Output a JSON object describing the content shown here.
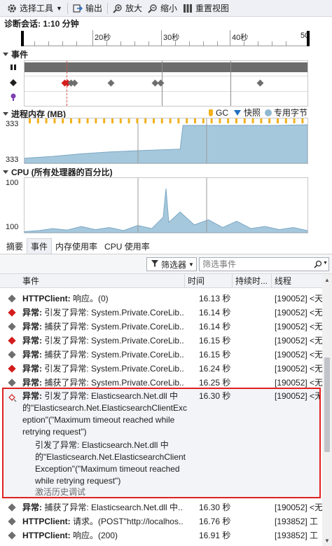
{
  "toolbar": {
    "select_tool": "选择工具",
    "export": "输出",
    "zoom_in": "放大",
    "zoom_out": "缩小",
    "reset_view": "重置视图"
  },
  "session": {
    "label": "诊断会话: 1:10 分钟"
  },
  "ruler": {
    "labels": [
      "20秒",
      "30秒",
      "40秒",
      "50"
    ]
  },
  "events_section": {
    "title": "事件"
  },
  "memory_section": {
    "title": "进程内存 (MB)",
    "y_max": "333",
    "y_min": "333"
  },
  "legend": {
    "gc": "GC",
    "snapshot": "快照",
    "private_bytes": "专用字节"
  },
  "cpu_section": {
    "title": "CPU (所有处理器的百分比)",
    "y_max": "100",
    "y_min": "100"
  },
  "chart_data": [
    {
      "type": "area",
      "title": "进程内存 (MB)",
      "ylim": [
        0,
        333
      ],
      "x": [
        0,
        0.1,
        0.2,
        0.3,
        0.4,
        0.5,
        0.55,
        0.56,
        0.6,
        0.7,
        0.8,
        0.9,
        1.0
      ],
      "values": [
        40,
        55,
        75,
        90,
        100,
        108,
        112,
        300,
        300,
        300,
        300,
        300,
        305
      ]
    },
    {
      "type": "area",
      "title": "CPU (所有处理器的百分比)",
      "ylim": [
        0,
        100
      ],
      "x": [
        0,
        0.05,
        0.1,
        0.15,
        0.2,
        0.25,
        0.3,
        0.35,
        0.4,
        0.45,
        0.49,
        0.5,
        0.51,
        0.55,
        0.6,
        0.65,
        0.7,
        0.75,
        0.8,
        0.85,
        0.9,
        0.95,
        1.0
      ],
      "values": [
        2,
        4,
        8,
        5,
        12,
        6,
        10,
        4,
        14,
        8,
        30,
        85,
        20,
        40,
        15,
        25,
        10,
        22,
        8,
        12,
        6,
        10,
        4
      ]
    }
  ],
  "tabs": [
    {
      "label": "摘要",
      "active": false
    },
    {
      "label": "事件",
      "active": true
    },
    {
      "label": "内存使用率",
      "active": false
    },
    {
      "label": "CPU 使用率",
      "active": false
    }
  ],
  "filter": {
    "button": "筛选器",
    "placeholder": "筛选事件"
  },
  "table": {
    "headers": [
      "事件",
      "时间",
      "持续时...",
      "线程"
    ],
    "rows": [
      {
        "icon": "gray",
        "event_bold": "HTTPClient:",
        "event_rest": " 响应。(0)",
        "time": "16.13 秒",
        "thread": "[190052] <天"
      },
      {
        "icon": "red",
        "event_bold": "异常:",
        "event_rest": " 引发了异常: System.Private.CoreLib...",
        "time": "16.14 秒",
        "thread": "[190052] <无"
      },
      {
        "icon": "gray",
        "event_bold": "异常:",
        "event_rest": " 捕获了异常: System.Private.CoreLib...",
        "time": "16.14 秒",
        "thread": "[190052] <无"
      },
      {
        "icon": "red",
        "event_bold": "异常:",
        "event_rest": " 引发了异常: System.Private.CoreLib...",
        "time": "16.15 秒",
        "thread": "[190052] <无"
      },
      {
        "icon": "gray",
        "event_bold": "异常:",
        "event_rest": " 捕获了异常: System.Private.CoreLib...",
        "time": "16.15 秒",
        "thread": "[190052] <无"
      },
      {
        "icon": "red",
        "event_bold": "异常:",
        "event_rest": " 引发了异常: System.Private.CoreLib...",
        "time": "16.24 秒",
        "thread": "[190052] <无"
      },
      {
        "icon": "gray",
        "event_bold": "异常:",
        "event_rest": " 捕获了异常: System.Private.CoreLib...",
        "time": "16.25 秒",
        "thread": "[190052] <无"
      }
    ],
    "selected": {
      "line1_bold": "异常:",
      "line1_rest": " 引发了异常: Elasticsearch.Net.dll 中",
      "line2": "的\"Elasticsearch.Net.ElasticsearchClientExc",
      "line3": "eption\"(\"Maximum timeout reached while",
      "line4": "retrying request\")",
      "time": "16.30 秒",
      "thread": "[190052] <无",
      "detail1": "引发了异常: Elasticsearch.Net.dll 中",
      "detail2": "的\"Elasticsearch.Net.ElasticsearchClient",
      "detail3": "Exception\"(\"Maximum timeout reached",
      "detail4": "while retrying request\")",
      "link": "激活历史调试"
    },
    "after_rows": [
      {
        "icon": "gray",
        "event_bold": "异常:",
        "event_rest": " 捕获了异常: Elasticsearch.Net.dll 中...",
        "time": "16.30 秒",
        "thread": "[190052] <无"
      },
      {
        "icon": "gray",
        "event_bold": "HTTPClient:",
        "event_rest": " 请求。(POST\"http://localhos...",
        "time": "16.76 秒",
        "thread": "[193852] 工"
      },
      {
        "icon": "gray",
        "event_bold": "HTTPClient:",
        "event_rest": " 响应。(200)",
        "time": "16.91 秒",
        "thread": "[193852] 工"
      }
    ]
  }
}
